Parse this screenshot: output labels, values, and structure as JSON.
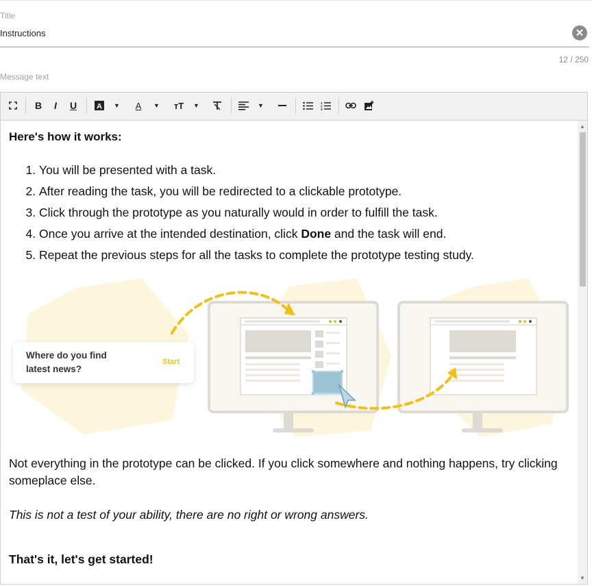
{
  "title_field": {
    "label": "Title",
    "value": "Instructions",
    "counter": "12 / 250"
  },
  "message_field": {
    "label": "Message text"
  },
  "toolbar": {
    "bold": "B",
    "italic": "I",
    "underline": "U",
    "text_color": "A",
    "font_size": "A",
    "text_size": "тT"
  },
  "content": {
    "heading": "Here's how it works:",
    "steps": [
      "You will be presented with a task.",
      "After reading the task, you will be redirected to a clickable prototype.",
      "Click through the prototype as you naturally would in order to fulfill the task.",
      "Once you arrive at the intended destination, click ",
      "Repeat the previous steps for all the tasks to complete the prototype testing study."
    ],
    "step4_bold": "Done",
    "step4_tail": " and the task will end.",
    "illustration": {
      "question": "Where do you find latest news?",
      "start": "Start",
      "question_line1": "Where do you find",
      "question_line2": "latest news?"
    },
    "note": "Not everything in the prototype can be clicked. If you click somewhere and nothing happens, try clicking someplace else.",
    "italic_note": "This is not a test of your ability, there are no right or wrong answers.",
    "closing": "That's it, let's get started!"
  },
  "colors": {
    "accent": "#f2c010",
    "hexagon": "#fdf6dc",
    "monitor": "#dcdad2",
    "highlight": "#9bc4d6"
  }
}
